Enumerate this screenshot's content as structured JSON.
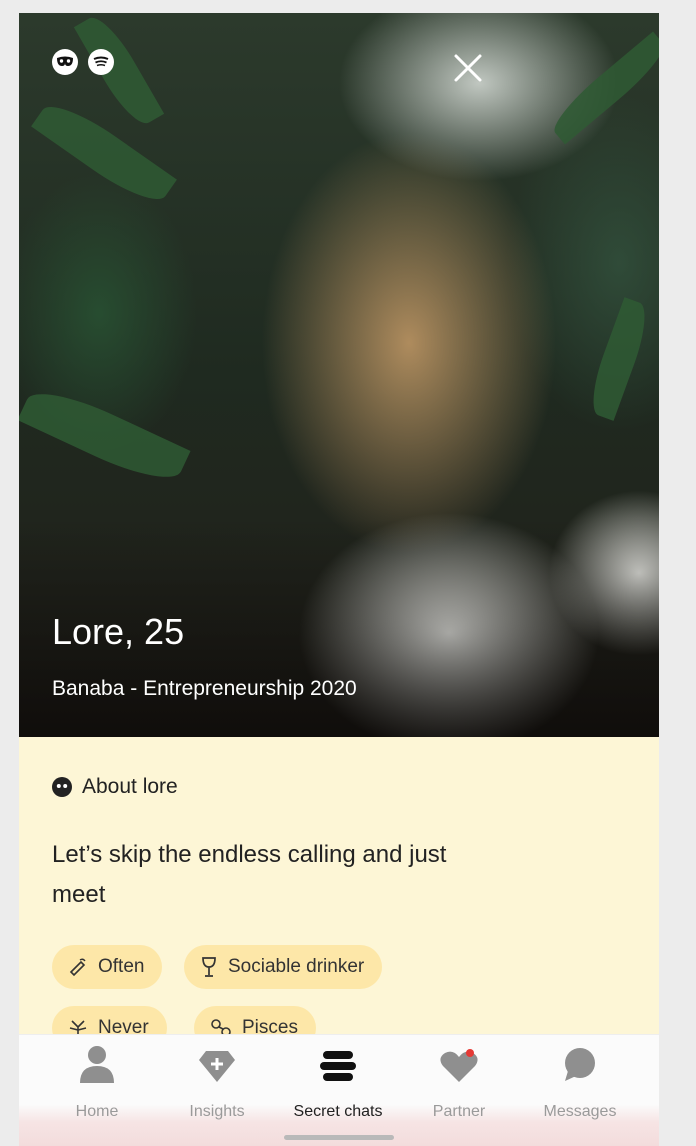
{
  "profile": {
    "name_age": "Lore, 25",
    "subtitle": "Banaba - Entrepreneurship 2020"
  },
  "top_icons": [
    "mask-icon",
    "spotify-icon"
  ],
  "close_icon": "close-icon",
  "about": {
    "title": "About lore",
    "bio": "Let’s skip the endless calling and just meet"
  },
  "chips": [
    {
      "label": "Often",
      "icon": "smoking-icon"
    },
    {
      "label": "Sociable drinker",
      "icon": "wine-glass-icon"
    },
    {
      "label": "Never",
      "icon": "cannabis-icon"
    },
    {
      "label": "Pisces",
      "icon": "zodiac-icon"
    }
  ],
  "nav": {
    "items": [
      {
        "label": "Home",
        "icon": "person-icon"
      },
      {
        "label": "Insights",
        "icon": "diamond-plus-icon"
      },
      {
        "label": "Secret chats",
        "icon": "secret-chats-icon"
      },
      {
        "label": "Partner",
        "icon": "heart-icon"
      },
      {
        "label": "Messages",
        "icon": "chat-bubble-icon"
      }
    ],
    "active": "Secret chats"
  },
  "colors": {
    "panel_bg": "#fdf6d6",
    "chip_bg": "#fde7a8",
    "notification_dot": "#e53935"
  }
}
